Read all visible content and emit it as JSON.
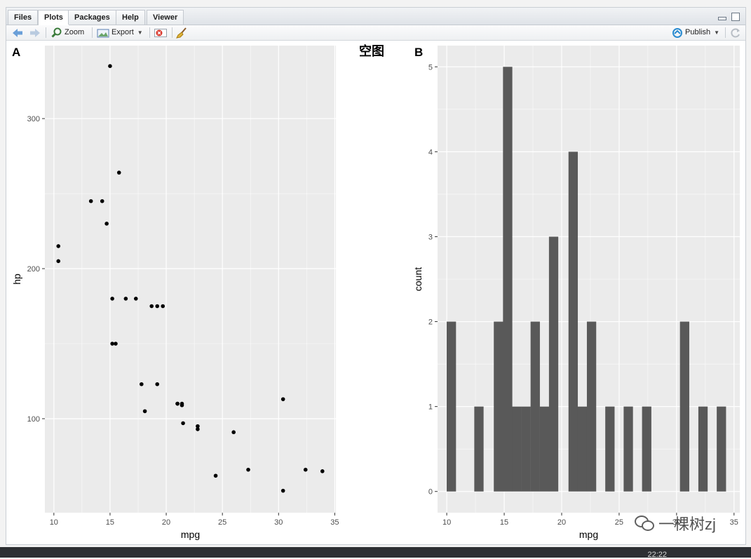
{
  "tabs": [
    {
      "label": "Files"
    },
    {
      "label": "Plots"
    },
    {
      "label": "Packages"
    },
    {
      "label": "Help"
    },
    {
      "label": "Viewer"
    }
  ],
  "toolbar": {
    "zoom_label": "Zoom",
    "export_label": "Export",
    "publish_label": "Publish"
  },
  "plot_title": "空图",
  "taskbar": {
    "clock": "22:22"
  },
  "watermark": {
    "text": "一棵树zj"
  },
  "colors": {
    "panel_bg": "#ebebeb",
    "grid": "#ffffff",
    "bar_fill": "#595959",
    "point": "#000000"
  },
  "chart_data": [
    {
      "type": "scatter",
      "tag": "A",
      "xlabel": "mpg",
      "ylabel": "hp",
      "xlim": [
        9.2,
        35.1
      ],
      "ylim": [
        37.35,
        348.65
      ],
      "x_ticks": [
        10,
        15,
        20,
        25,
        30,
        35
      ],
      "y_ticks": [
        100,
        200,
        300
      ],
      "points": [
        [
          21.0,
          110
        ],
        [
          21.0,
          110
        ],
        [
          22.8,
          93
        ],
        [
          21.4,
          110
        ],
        [
          18.7,
          175
        ],
        [
          18.1,
          105
        ],
        [
          14.3,
          245
        ],
        [
          24.4,
          62
        ],
        [
          22.8,
          95
        ],
        [
          19.2,
          123
        ],
        [
          17.8,
          123
        ],
        [
          16.4,
          180
        ],
        [
          17.3,
          180
        ],
        [
          15.2,
          180
        ],
        [
          10.4,
          205
        ],
        [
          10.4,
          215
        ],
        [
          14.7,
          230
        ],
        [
          32.4,
          66
        ],
        [
          30.4,
          52
        ],
        [
          33.9,
          65
        ],
        [
          21.5,
          97
        ],
        [
          15.5,
          150
        ],
        [
          15.2,
          150
        ],
        [
          13.3,
          245
        ],
        [
          19.2,
          175
        ],
        [
          27.3,
          66
        ],
        [
          26.0,
          91
        ],
        [
          30.4,
          113
        ],
        [
          15.8,
          264
        ],
        [
          19.7,
          175
        ],
        [
          15.0,
          335
        ],
        [
          21.4,
          109
        ]
      ]
    },
    {
      "type": "bar",
      "tag": "B",
      "xlabel": "mpg",
      "ylabel": "count",
      "xlim": [
        9.2,
        35.5
      ],
      "ylim": [
        -0.25,
        5.25
      ],
      "x_ticks": [
        10,
        15,
        20,
        25,
        30,
        35
      ],
      "y_ticks": [
        0,
        1,
        2,
        3,
        4,
        5
      ],
      "binwidth": 0.810345,
      "bins": [
        {
          "x": 10.4,
          "count": 2
        },
        {
          "x": 12.8,
          "count": 1
        },
        {
          "x": 14.5,
          "count": 2
        },
        {
          "x": 15.3,
          "count": 5
        },
        {
          "x": 16.1,
          "count": 1
        },
        {
          "x": 16.9,
          "count": 1
        },
        {
          "x": 17.7,
          "count": 2
        },
        {
          "x": 18.5,
          "count": 1
        },
        {
          "x": 19.3,
          "count": 3
        },
        {
          "x": 21.0,
          "count": 4
        },
        {
          "x": 21.8,
          "count": 1
        },
        {
          "x": 22.6,
          "count": 2
        },
        {
          "x": 24.2,
          "count": 1
        },
        {
          "x": 25.8,
          "count": 1
        },
        {
          "x": 27.4,
          "count": 1
        },
        {
          "x": 30.7,
          "count": 2
        },
        {
          "x": 32.3,
          "count": 1
        },
        {
          "x": 33.9,
          "count": 1
        }
      ]
    }
  ]
}
